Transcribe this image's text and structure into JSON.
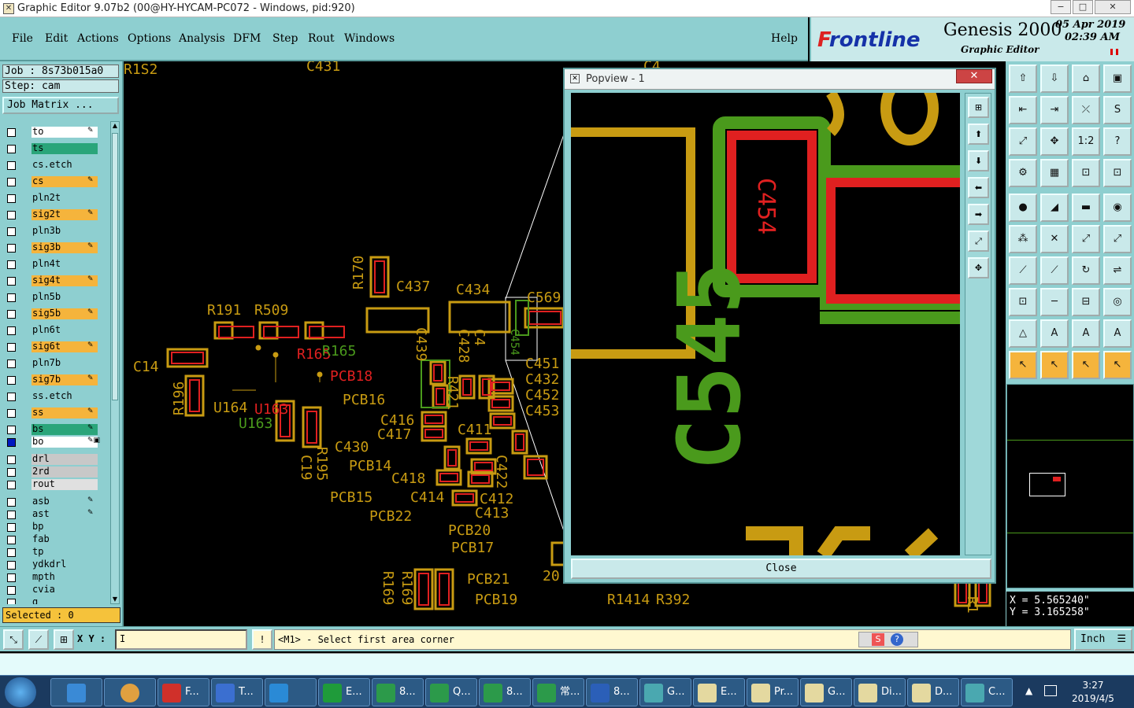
{
  "window": {
    "title": "Graphic Editor 9.07b2 (00@HY-HYCAM-PC072 - Windows, pid:920)",
    "min": "−",
    "max": "□",
    "close": "✕"
  },
  "menu": {
    "file": "File",
    "edit": "Edit",
    "actions": "Actions",
    "options": "Options",
    "analysis": "Analysis",
    "dfm": "DFM",
    "step": "Step",
    "rout": "Rout",
    "windows": "Windows",
    "help": "Help"
  },
  "brand": {
    "logo_f": "F",
    "logo_rest": "rontline",
    "product": "Genesis 2000",
    "subtitle": "Graphic Editor",
    "date": "05 Apr 2019",
    "time": "02:39 AM"
  },
  "job": {
    "job": "Job : 8s73b015a0",
    "step": "Step: cam",
    "matrix": "Job Matrix ..."
  },
  "layers": [
    {
      "name": "to",
      "color": "#ffffff",
      "pen": "✎"
    },
    {
      "name": "ts",
      "color": "#2aa57a",
      "pen": ""
    },
    {
      "name": "cs.etch",
      "color": "#8ecfd0",
      "pen": ""
    },
    {
      "name": "cs",
      "color": "#f5b43c",
      "pen": "✎"
    },
    {
      "name": "pln2t",
      "color": "#8ecfd0",
      "pen": ""
    },
    {
      "name": "sig2t",
      "color": "#f5b43c",
      "pen": "✎"
    },
    {
      "name": "pln3b",
      "color": "#8ecfd0",
      "pen": ""
    },
    {
      "name": "sig3b",
      "color": "#f5b43c",
      "pen": "✎"
    },
    {
      "name": "pln4t",
      "color": "#8ecfd0",
      "pen": ""
    },
    {
      "name": "sig4t",
      "color": "#f5b43c",
      "pen": "✎"
    },
    {
      "name": "pln5b",
      "color": "#8ecfd0",
      "pen": ""
    },
    {
      "name": "sig5b",
      "color": "#f5b43c",
      "pen": "✎"
    },
    {
      "name": "pln6t",
      "color": "#8ecfd0",
      "pen": ""
    },
    {
      "name": "sig6t",
      "color": "#f5b43c",
      "pen": "✎"
    },
    {
      "name": "pln7b",
      "color": "#8ecfd0",
      "pen": ""
    },
    {
      "name": "sig7b",
      "color": "#f5b43c",
      "pen": "✎"
    },
    {
      "name": "ss.etch",
      "color": "#8ecfd0",
      "pen": ""
    },
    {
      "name": "ss",
      "color": "#f5b43c",
      "pen": "✎"
    },
    {
      "name": "bs",
      "color": "#2aa57a",
      "pen": "✎"
    },
    {
      "name": "bo",
      "color": "#ffffff",
      "pen": "✎▣"
    },
    {
      "name": "drl",
      "color": "#c8c8c8",
      "pen": ""
    },
    {
      "name": "2rd",
      "color": "#c8c8c8",
      "pen": ""
    },
    {
      "name": "rout",
      "color": "#e0e0e0",
      "pen": ""
    },
    {
      "name": "asb",
      "color": "#8ecfd0",
      "pen": "✎"
    },
    {
      "name": "ast",
      "color": "#8ecfd0",
      "pen": "✎"
    },
    {
      "name": "bp",
      "color": "#8ecfd0",
      "pen": ""
    },
    {
      "name": "fab",
      "color": "#8ecfd0",
      "pen": ""
    },
    {
      "name": "tp",
      "color": "#8ecfd0",
      "pen": ""
    },
    {
      "name": "ydkdrl",
      "color": "#8ecfd0",
      "pen": ""
    },
    {
      "name": "mpth",
      "color": "#8ecfd0",
      "pen": ""
    },
    {
      "name": "cvia",
      "color": "#8ecfd0",
      "pen": ""
    },
    {
      "name": "g",
      "color": "#8ecfd0",
      "pen": ""
    }
  ],
  "selected": "Selected : 0",
  "canvas_labels": {
    "l1": "C437",
    "l2": "C434",
    "l3": "R509",
    "l4": "R191",
    "l5": "R170",
    "l6": "C14",
    "l7": "R196",
    "l8": "U164",
    "l9": "U163",
    "l10": "C416",
    "l11": "C417",
    "l12": "C411",
    "l13": "C430",
    "l14": "PCB14",
    "l15": "C418",
    "l16": "C414",
    "l17": "C412",
    "l18": "C413",
    "l19": "PCB15",
    "l20": "PCB22",
    "l21": "PCB20",
    "l22": "PCB17",
    "l23": "PCB21",
    "l24": "PCB19",
    "l25": "R392",
    "l26": "R1414",
    "l27": "PCB16",
    "l28": "C19",
    "l29": "R195",
    "l30": "PCB18",
    "l31": "R165",
    "l32": "C451",
    "l33": "C432",
    "l34": "C452",
    "l35": "C453",
    "l36": "C439",
    "l37": "C428",
    "l38": "C4",
    "l39": "R421",
    "l40": "R169",
    "l41": "R169",
    "l42": "C431",
    "l43": "C422",
    "l44": "C569",
    "l45": "C4",
    "l46": "C4",
    "l47": "20",
    "l48": "C454",
    "l49": "R1",
    "l50": "R1S2"
  },
  "popview": {
    "title": "Popview - 1",
    "close_x": "✕",
    "close_btn": "Close",
    "big_label": "C545",
    "small_label": "C454"
  },
  "coords": {
    "x": "X = 5.565240\"",
    "y": "Y = 3.165258\""
  },
  "status": {
    "xy_label": "X Y :",
    "xy_value": "I",
    "message": "<M1> - Select first area corner",
    "unit": "Inch"
  },
  "taskbar": {
    "items": [
      {
        "label": "F...",
        "color": "#d0302a"
      },
      {
        "label": "T...",
        "color": "#3b6fd0"
      },
      {
        "label": "",
        "color": "#2a8ad6"
      },
      {
        "label": "E...",
        "color": "#1f9b3a"
      },
      {
        "label": "8...",
        "color": "#2c9a4a"
      },
      {
        "label": "Q...",
        "color": "#2c9a4a"
      },
      {
        "label": "8...",
        "color": "#2c9a4a"
      },
      {
        "label": "常...",
        "color": "#2c9a4a"
      },
      {
        "label": "8...",
        "color": "#2b5fb8"
      },
      {
        "label": "G...",
        "color": "#4aa8b0"
      },
      {
        "label": "E...",
        "color": "#e4d9a0"
      },
      {
        "label": "Pr...",
        "color": "#e4d9a0"
      },
      {
        "label": "G...",
        "color": "#e4d9a0"
      },
      {
        "label": "Di...",
        "color": "#e4d9a0"
      },
      {
        "label": "D...",
        "color": "#e4d9a0"
      },
      {
        "label": "C...",
        "color": "#4aa8b0"
      }
    ],
    "time": "3:27",
    "date": "2019/4/5"
  }
}
